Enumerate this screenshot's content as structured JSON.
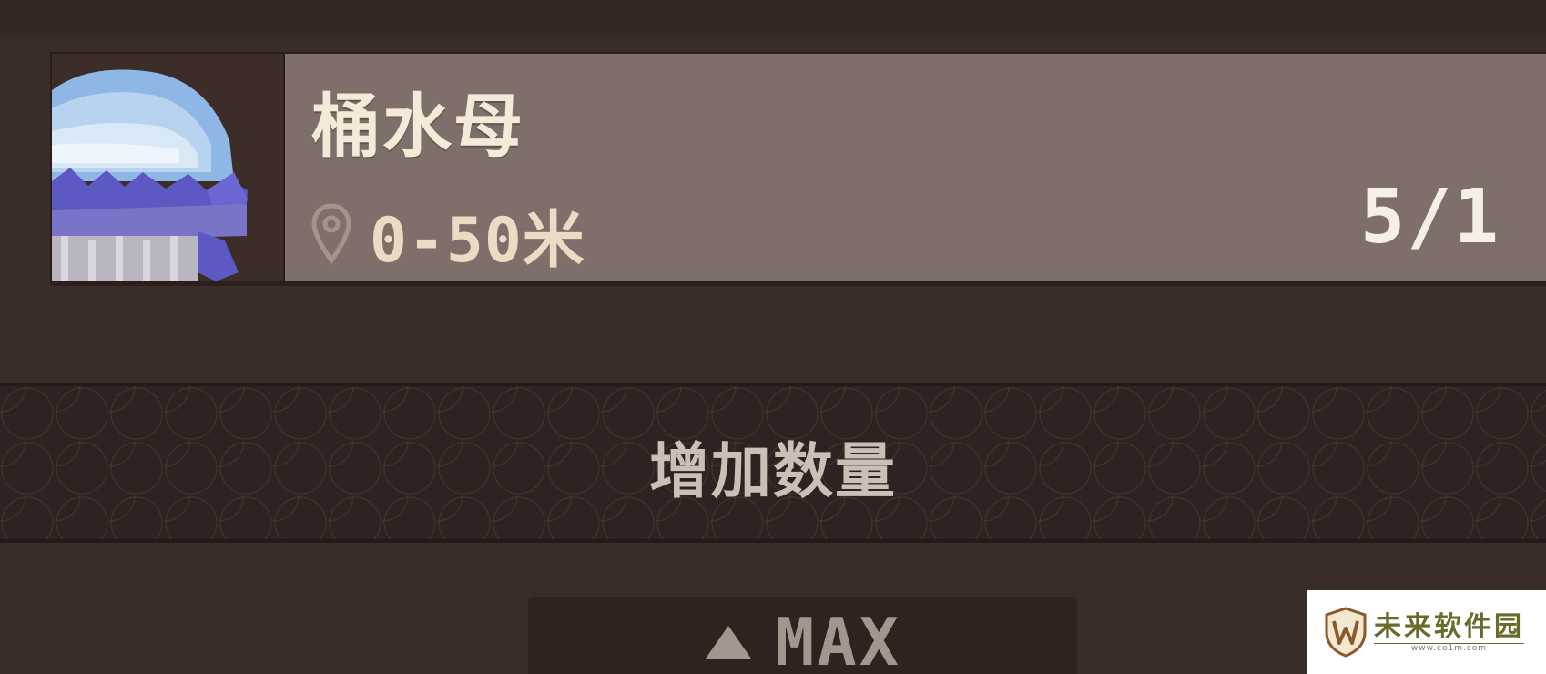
{
  "item": {
    "name": "桶水母",
    "depth": "0-50米",
    "count": "5/1",
    "icon": "jellyfish-sprite"
  },
  "actions": {
    "increase_label": "增加数量",
    "max_label": "MAX",
    "max_icon": "triangle-up-icon"
  },
  "watermark": {
    "title": "未来软件园",
    "url": "www.co1m.com"
  },
  "colors": {
    "background": "#3a2d29",
    "card": "#7e6f6a",
    "banner": "#2e2320",
    "text_light": "#f3ead8"
  }
}
